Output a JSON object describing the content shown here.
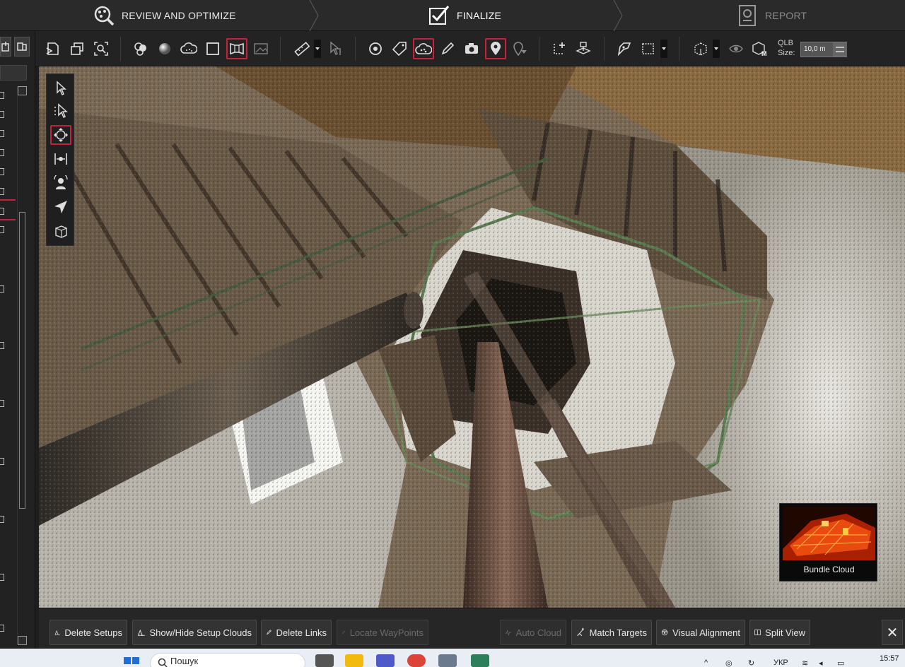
{
  "workflow": {
    "steps": [
      {
        "label": "REVIEW AND OPTIMIZE",
        "state": "completed"
      },
      {
        "label": "FINALIZE",
        "state": "active"
      },
      {
        "label": "REPORT",
        "state": "inactive"
      }
    ]
  },
  "toolbar": {
    "qlb_label": "QLB\nSize:",
    "qlb_value": "10,0 m"
  },
  "viewport": {
    "minimap_caption": "Bundle Cloud"
  },
  "bottom_bar": {
    "buttons": [
      {
        "label": "Delete Setups",
        "enabled": true
      },
      {
        "label": "Show/Hide Setup Clouds",
        "enabled": true
      },
      {
        "label": "Delete Links",
        "enabled": true
      },
      {
        "label": "Locate WayPoints",
        "enabled": false
      },
      {
        "label": "Auto Cloud",
        "enabled": false
      },
      {
        "label": "Match Targets",
        "enabled": true
      },
      {
        "label": "Visual Alignment",
        "enabled": true
      },
      {
        "label": "Split View",
        "enabled": true
      }
    ],
    "close_label": "✕"
  },
  "taskbar": {
    "search_placeholder": "Пошук",
    "language": "УКР",
    "time": "15:57"
  },
  "colors": {
    "accent": "#c4243b",
    "panel": "#232323",
    "taskbar": "#e9eef5"
  }
}
